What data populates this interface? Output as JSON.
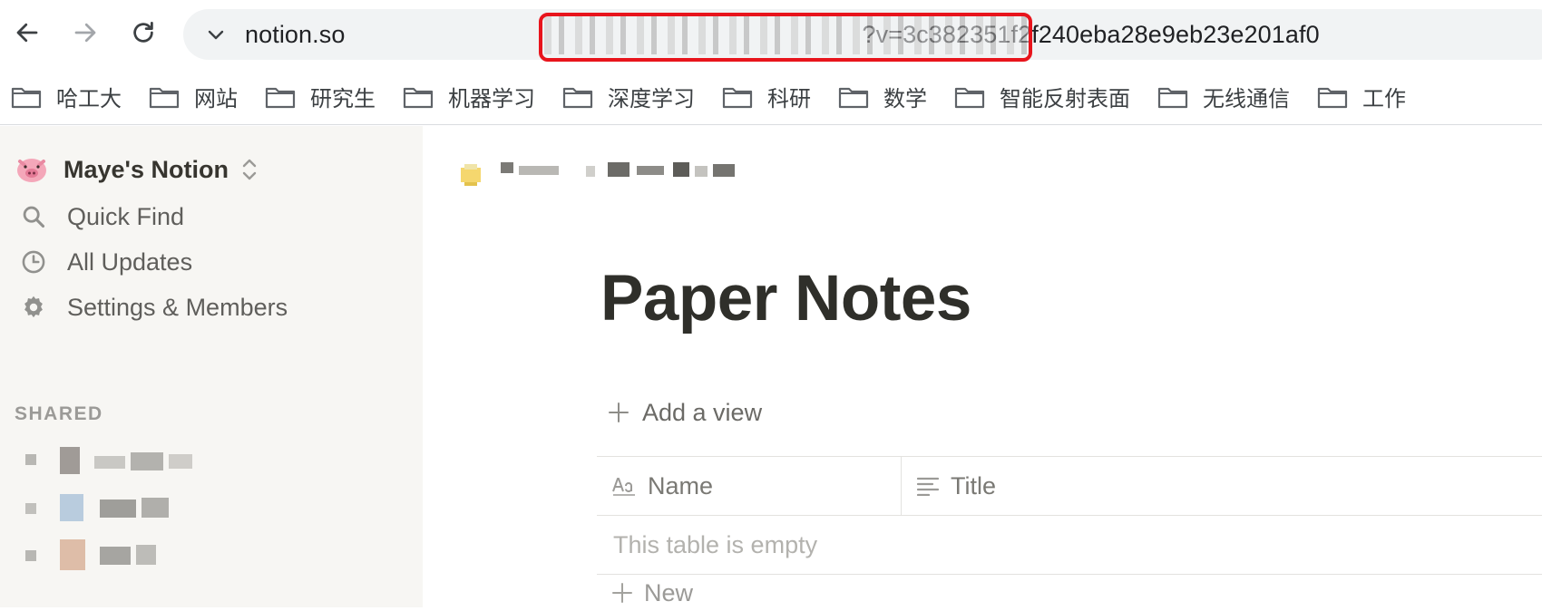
{
  "browser": {
    "url_visible_start": "notion.so",
    "url_visible_end": "?v=3c382351f2f240eba28e9eb23e201af0",
    "icons": {
      "back": "arrow-left-icon",
      "forward": "arrow-right-icon",
      "reload": "reload-icon",
      "expand": "chevron-down-icon"
    },
    "highlight_color": "#e8141c",
    "bookmarks": [
      {
        "label": "哈工大",
        "icon": "folder-icon"
      },
      {
        "label": "网站",
        "icon": "folder-icon"
      },
      {
        "label": "研究生",
        "icon": "folder-icon"
      },
      {
        "label": "机器学习",
        "icon": "folder-icon"
      },
      {
        "label": "深度学习",
        "icon": "folder-icon"
      },
      {
        "label": "科研",
        "icon": "folder-icon"
      },
      {
        "label": "数学",
        "icon": "folder-icon"
      },
      {
        "label": "智能反射表面",
        "icon": "folder-icon"
      },
      {
        "label": "无线通信",
        "icon": "folder-icon"
      },
      {
        "label": "工作",
        "icon": "folder-icon"
      }
    ]
  },
  "sidebar": {
    "workspace_name": "Maye's Notion",
    "workspace_icon": "pig-emoji-icon",
    "items": [
      {
        "label": "Quick Find",
        "icon": "search-icon"
      },
      {
        "label": "All Updates",
        "icon": "clock-icon"
      },
      {
        "label": "Settings & Members",
        "icon": "gear-icon"
      }
    ],
    "shared_label": "SHARED",
    "background": "#f7f6f3"
  },
  "page": {
    "title": "Paper Notes",
    "add_view_label": "Add a view",
    "columns": [
      {
        "label": "Name",
        "icon": "text-type-icon"
      },
      {
        "label": "Title",
        "icon": "text-lines-icon"
      }
    ],
    "empty_message": "This table is empty",
    "new_label": "New"
  }
}
